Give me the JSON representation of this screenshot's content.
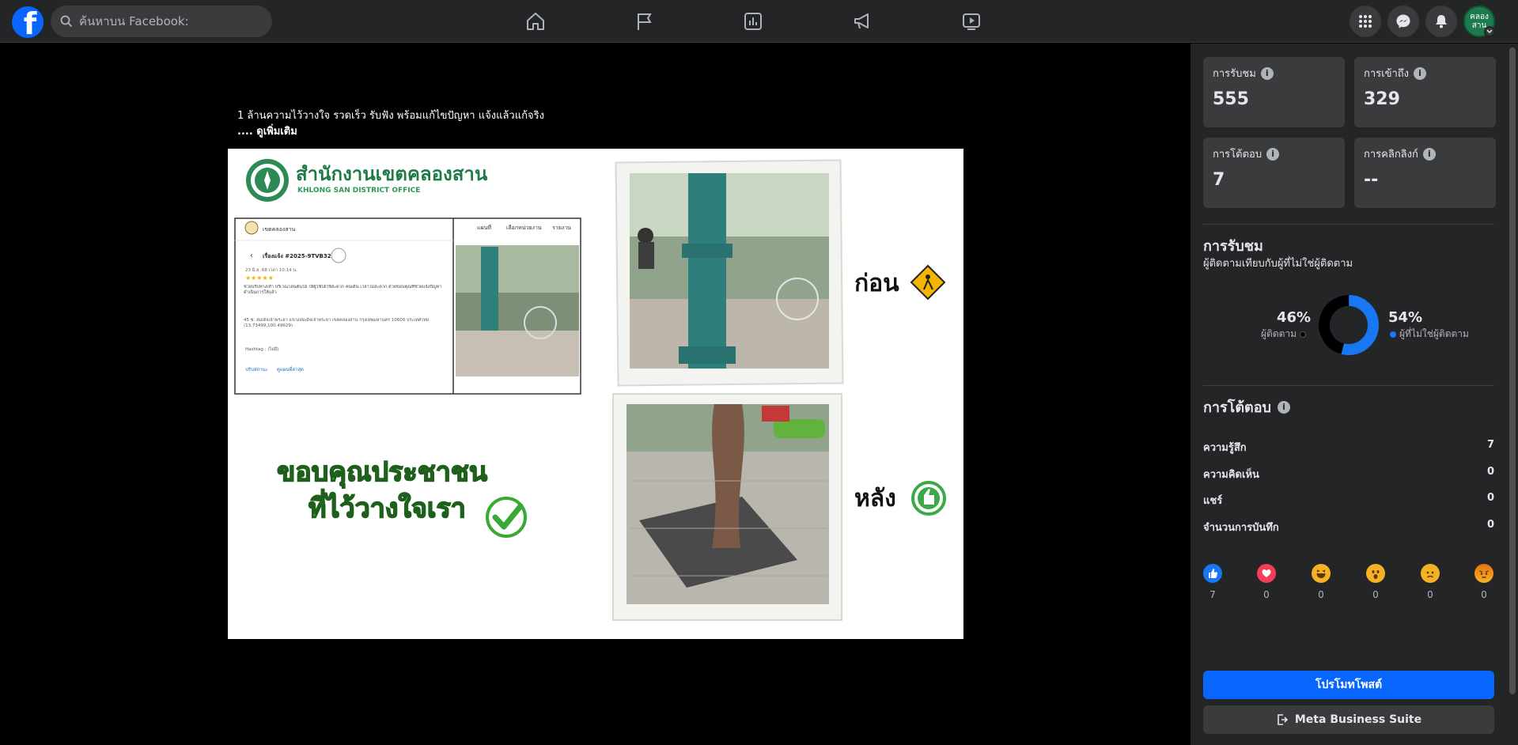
{
  "topbar": {
    "logo_letter": "f",
    "search_placeholder": "ค้นหาบน Facebook:",
    "nav_icons": [
      "home-icon",
      "pages-flag-icon",
      "insights-chart-icon",
      "ads-megaphone-icon",
      "video-icon"
    ],
    "right_icons": [
      "menu-grid-icon",
      "messenger-icon",
      "notifications-bell-icon"
    ],
    "avatar_text": [
      "คลอง",
      "สาน"
    ]
  },
  "post": {
    "caption": "1 ล้านความไว้วางใจ รวดเร็ว รับฟัง พร้อมแก้ไขปัญหา แจ้งแล้วแก้จริง",
    "see_more": ".... ดูเพิ่มเติม",
    "image": {
      "office_name_th": "สำนักงานเขตคลองสาน",
      "office_name_en": "KHLONG SAN DISTRICT OFFICE",
      "before_label": "ก่อน",
      "after_label": "หลัง",
      "thanks_line1": "ขอบคุณประชาชน",
      "thanks_line2": "ที่ไว้วางใจเรา",
      "ticket_id": "เรื่องแจ้ง #2025-9TVB32",
      "ticket_org": "เขตคลองสาน",
      "ticket_tabs": [
        "แผนที่",
        "เลือกหน่วยงาน",
        "รายงาน"
      ],
      "ticket_date": "23 มิ.ย. 68 เวลา 10:14 น.",
      "ticket_desc": "ช่วยปรับทางเท้า บริเวณโคนต้นไม้ ให้ผู้ใช้ได้ใช้สะดวก คนเดิน เวลาไม่สะดวก ด้วยขอบคุณที่ช่วยแจ้งปัญหา ดำเนินการให้แล้ว",
      "ticket_addr": "45 ซ. สมเด็จเจ้าพระยา แขวงสมเด็จเจ้าพระยา เขตคลองสาน กรุงเทพมหานคร 10600 ประเทศไทย (13.73499,100.49629)",
      "ticket_hashtag": "Hashtag : (ไม่มี)",
      "ticket_links": [
        "ปรับสถานะ",
        "ดูแผนที่ล่าสุด"
      ]
    }
  },
  "stats": [
    {
      "label": "การรับชม",
      "value": "555"
    },
    {
      "label": "การเข้าถึง",
      "value": "329"
    },
    {
      "label": "การโต้ตอบ",
      "value": "7"
    },
    {
      "label": "การคลิกลิงก์",
      "value": "--"
    }
  ],
  "views": {
    "title": "การรับชม",
    "subtitle": "ผู้ติดตามเทียบกับผู้ที่ไม่ใช่ผู้ติดตาม",
    "followers_pct": "46%",
    "followers_label": "ผู้ติดตาม",
    "non_followers_pct": "54%",
    "non_followers_label": "ผู้ที่ไม่ใช่ผู้ติดตาม",
    "followers_fraction": 0.46,
    "followers_color": "#000000",
    "non_followers_color": "#1877f2"
  },
  "engagement": {
    "title": "การโต้ตอบ",
    "rows": [
      {
        "label": "ความรู้สึก",
        "value": "7"
      },
      {
        "label": "ความคิดเห็น",
        "value": "0"
      },
      {
        "label": "แชร์",
        "value": "0"
      },
      {
        "label": "จำนวนการบันทึก",
        "value": "0"
      }
    ],
    "reactions": [
      {
        "icon": "like-icon",
        "count": "7"
      },
      {
        "icon": "love-icon",
        "count": "0"
      },
      {
        "icon": "haha-icon",
        "count": "0"
      },
      {
        "icon": "wow-icon",
        "count": "0"
      },
      {
        "icon": "sad-icon",
        "count": "0"
      },
      {
        "icon": "angry-icon",
        "count": "0"
      }
    ]
  },
  "buttons": {
    "promote": "โปรโมทโพสต์",
    "business_suite": "Meta Business Suite"
  }
}
